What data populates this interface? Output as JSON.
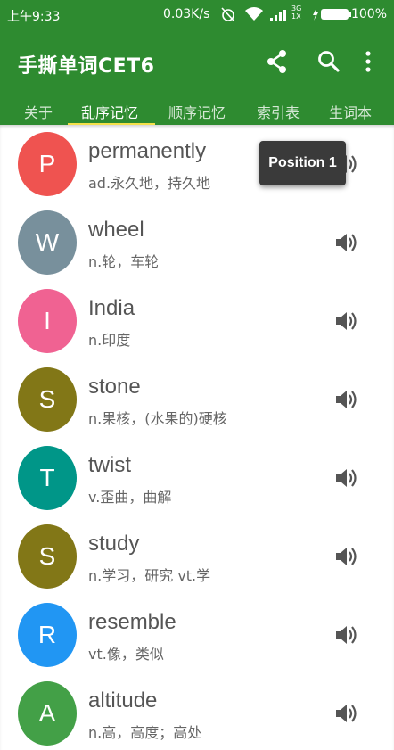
{
  "status_bar": {
    "time": "上午9:33",
    "network_speed": "0.03K/s",
    "signal_label_top": "3G",
    "signal_label_bottom": "1X",
    "battery": "100%"
  },
  "app_bar": {
    "title": "手撕单词CET6",
    "actions": [
      "share-icon",
      "search-icon",
      "more-vert-icon"
    ]
  },
  "tabs": [
    {
      "label": "关于",
      "active": false
    },
    {
      "label": "乱序记忆",
      "active": true
    },
    {
      "label": "顺序记忆",
      "active": false
    },
    {
      "label": "索引表",
      "active": false
    },
    {
      "label": "生词本",
      "active": false
    }
  ],
  "words": [
    {
      "letter": "P",
      "word": "permanently",
      "meaning": "ad.永久地，持久地",
      "color": "#ef5350"
    },
    {
      "letter": "W",
      "word": "wheel",
      "meaning": "n.轮，车轮",
      "color": "#78909c"
    },
    {
      "letter": "I",
      "word": "India",
      "meaning": "n.印度",
      "color": "#f06292"
    },
    {
      "letter": "S",
      "word": "stone",
      "meaning": "n.果核，(水果的)硬核",
      "color": "#827717"
    },
    {
      "letter": "T",
      "word": "twist",
      "meaning": "v.歪曲，曲解",
      "color": "#009688"
    },
    {
      "letter": "S",
      "word": "study",
      "meaning": "n.学习，研究 vt.学",
      "color": "#827717"
    },
    {
      "letter": "R",
      "word": "resemble",
      "meaning": "vt.像，类似",
      "color": "#2196f3"
    },
    {
      "letter": "A",
      "word": "altitude",
      "meaning": "n.高，高度；高处",
      "color": "#43a047"
    }
  ],
  "tooltip": {
    "text": "Position 1"
  },
  "colors": {
    "primary": "#2e8b30",
    "indicator": "#f5e14a"
  }
}
